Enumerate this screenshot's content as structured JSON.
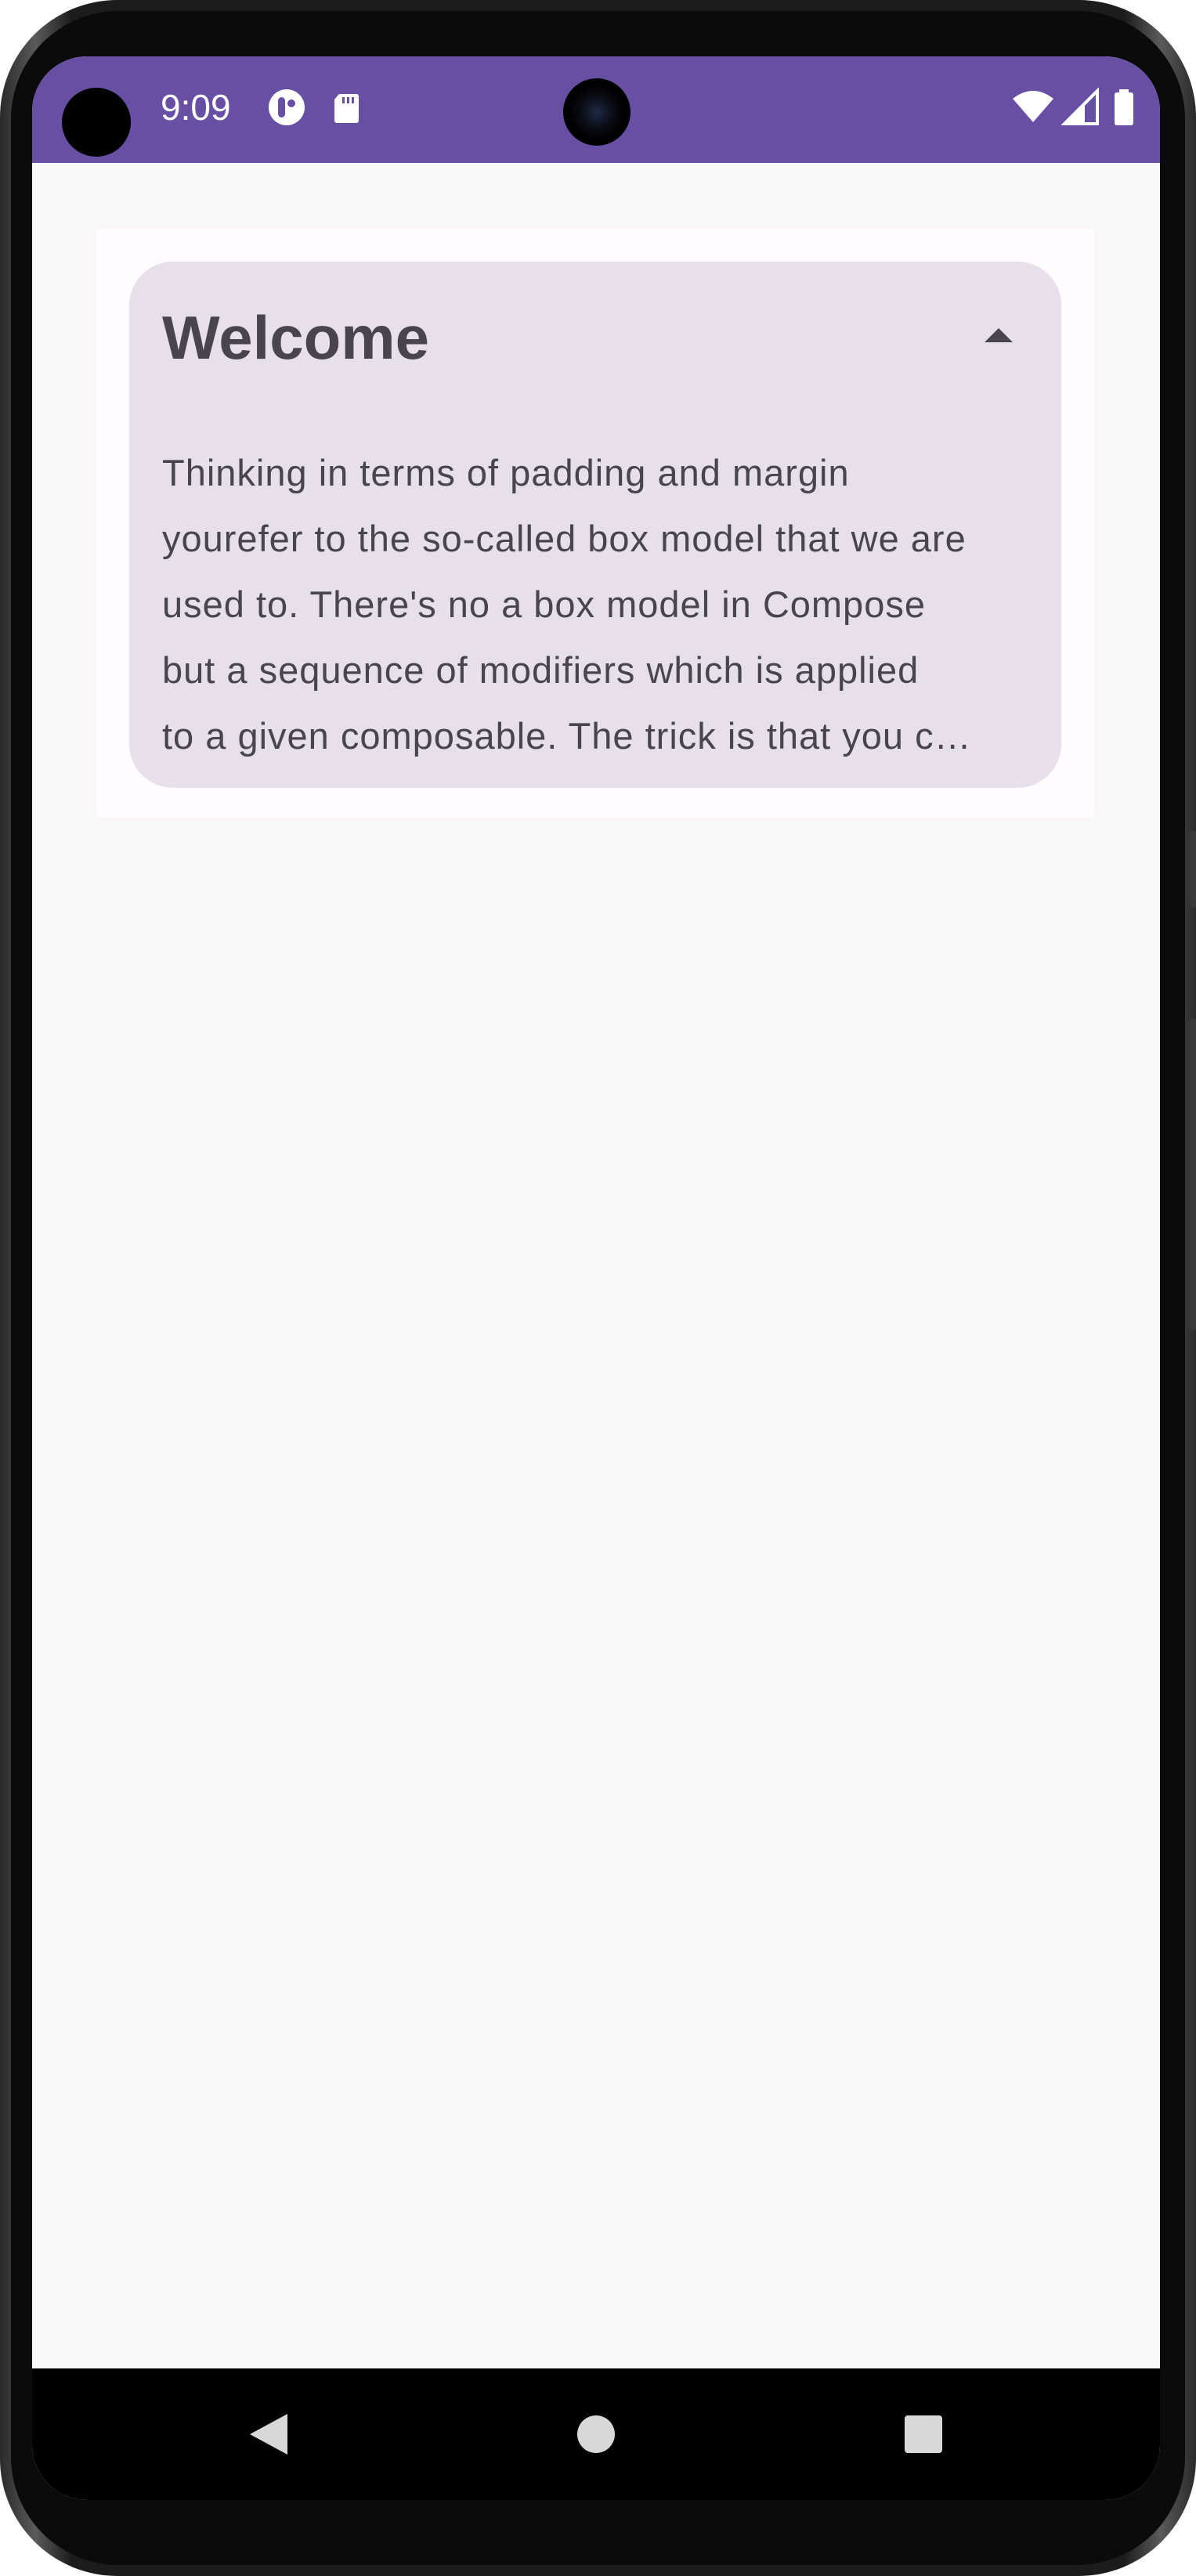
{
  "status_bar": {
    "time": "9:09",
    "background_color": "#6750a4",
    "icons": [
      "notification-app-icon",
      "sd-card-icon",
      "wifi-icon",
      "cellular-signal-icon",
      "battery-icon"
    ]
  },
  "card": {
    "title": "Welcome",
    "body_lines": [
      "Thinking in terms of padding and margin",
      "yourefer to the so-called box model that we are",
      "used to. There's no a box model in Compose",
      "but a sequence of modifiers which is applied",
      "to a given composable. The trick is that you c…"
    ],
    "expanded": true,
    "background_color": "#e7e0eb",
    "toggle_icon": "collapse-arrow-icon"
  },
  "navigation_bar": {
    "buttons": [
      "back-icon",
      "home-icon",
      "recents-icon"
    ]
  }
}
